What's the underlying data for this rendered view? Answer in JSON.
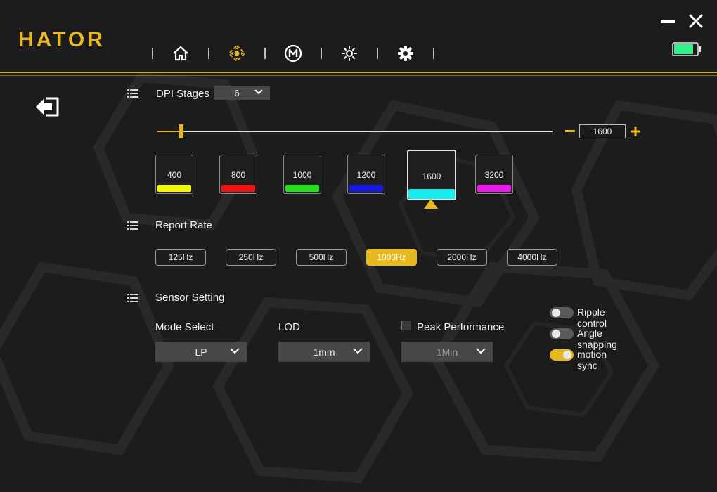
{
  "app": {
    "logo": "HATOR"
  },
  "colors": {
    "accent": "#e6b91f",
    "battery": "#2ef28a"
  },
  "nav": [
    {
      "icon": "home-icon"
    },
    {
      "icon": "dpi-crosshair-icon",
      "active": true
    },
    {
      "icon": "macro-m-icon"
    },
    {
      "icon": "brightness-icon"
    },
    {
      "icon": "gear-icon"
    }
  ],
  "dpi": {
    "heading": "DPI Stages",
    "stage_count": "6",
    "current_value": "1600",
    "slider_fraction": 0.06,
    "stages": [
      {
        "value": "400",
        "color": "#f7f700"
      },
      {
        "value": "800",
        "color": "#f21212"
      },
      {
        "value": "1000",
        "color": "#22e01d"
      },
      {
        "value": "1200",
        "color": "#1818e6"
      },
      {
        "value": "1600",
        "color": "#16ecec",
        "selected": true
      },
      {
        "value": "3200",
        "color": "#ef16ef"
      }
    ]
  },
  "report_rate": {
    "heading": "Report Rate",
    "options": [
      "125Hz",
      "250Hz",
      "500Hz",
      "1000Hz",
      "2000Hz",
      "4000Hz"
    ],
    "selected": "1000Hz"
  },
  "sensor": {
    "heading": "Sensor Setting",
    "mode_label": "Mode Select",
    "mode_value": "LP",
    "lod_label": "LOD",
    "lod_value": "1mm",
    "peak_label": "Peak Performance",
    "peak_value": "1Min",
    "toggles": [
      {
        "label": "Ripple control",
        "on": false
      },
      {
        "label": "Angle snapping",
        "on": false
      },
      {
        "label": "motion sync",
        "on": true
      }
    ]
  }
}
